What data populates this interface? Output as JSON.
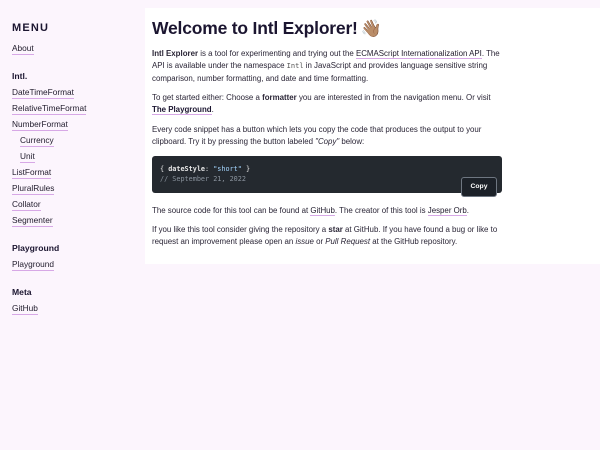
{
  "sidebar": {
    "menu_title": "MENU",
    "about_label": "About",
    "intl_heading": "Intl.",
    "intl_items": {
      "datetimeformat": "DateTimeFormat",
      "relativetimeformat": "RelativeTimeFormat",
      "numberformat": "NumberFormat",
      "currency": "Currency",
      "unit": "Unit",
      "listformat": "ListFormat",
      "pluralrules": "PluralRules",
      "collator": "Collator",
      "segmenter": "Segmenter"
    },
    "playground_heading": "Playground",
    "playground_label": "Playground",
    "meta_heading": "Meta",
    "github_label": "GitHub"
  },
  "main": {
    "title": "Welcome to Intl Explorer!",
    "title_emoji": "👋🏽",
    "p1": {
      "brand": "Intl Explorer",
      "t1": " is a tool for experimenting and trying out the ",
      "api_link": "ECMAScript Internationalization API",
      "t2": ". The API is available under the namespace ",
      "code": "Intl",
      "t3": " in JavaScript and provides language sensitive string comparison, number formatting, and date and time formatting."
    },
    "p2": {
      "t1": "To get started either: Choose a ",
      "formatter": "formatter",
      "t2": " you are interested in from the navigation menu. Or visit ",
      "playground_link": "The Playground",
      "t3": "."
    },
    "p3": {
      "t1": "Every code snippet has a button which lets you copy the code that produces the output to your clipboard. Try it by pressing the button labeled ",
      "copy_quote": "\"Copy\"",
      "t2": " below:"
    },
    "code": {
      "open": "{",
      "key": "dateStyle",
      "colon": ": ",
      "value": "\"short\"",
      "close": "}",
      "comment": "// September 21, 2022",
      "copy_label": "Copy"
    },
    "p4": {
      "t1": "The source code for this tool can be found at ",
      "github_link": "GitHub",
      "t2": ". The creator of this tool is ",
      "author_link": "Jesper Orb",
      "t3": "."
    },
    "p5": {
      "t1": "If you like this tool consider giving the repository a ",
      "star": "star",
      "t2": " at GitHub. If you have found a bug or like to request an improvement please open an ",
      "issue": "issue",
      "t3": " or ",
      "pr": "Pull Request",
      "t4": " at the GitHub repository."
    }
  },
  "colors": {
    "page_background": "#fcf5fd",
    "content_background": "#ffffff",
    "link_underline": "#d7a8e6",
    "code_background": "#24292f"
  },
  "icons": {
    "title_emoji": "waving-hand-icon"
  }
}
